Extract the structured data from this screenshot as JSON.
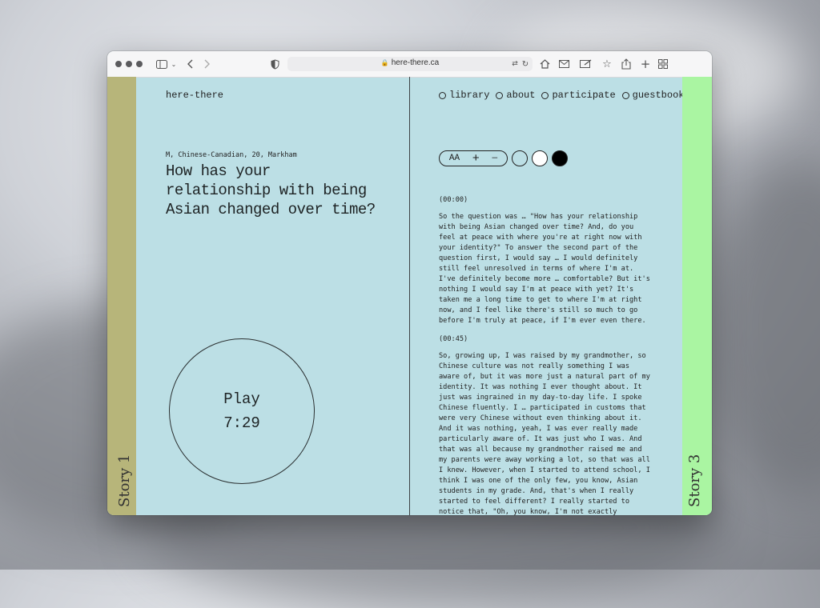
{
  "browser": {
    "url": "here-there.ca"
  },
  "site": {
    "logo": "here-there",
    "nav": [
      "library",
      "about",
      "participate",
      "guestbook"
    ]
  },
  "stories": {
    "left_label": "Story 1",
    "right_label": "Story 3",
    "left_color": "#b7b57a",
    "right_color": "#aaf5a2",
    "page_color": "#bcdfe5"
  },
  "story": {
    "meta": "M, Chinese-Canadian, 20, Markham",
    "question": "How has your relationship with being Asian changed over time?",
    "play_label": "Play",
    "duration": "7:29"
  },
  "controls": {
    "text_size_label": "AA",
    "increase_label": "+",
    "decrease_label": "—",
    "themes": [
      "transparent",
      "#ffffff",
      "#000000"
    ]
  },
  "transcript": [
    {
      "time": "(00:00)",
      "text": "So the question was … \"How has your relationship with being Asian changed over time? And, do you feel at peace with where you're at right now with your identity?\" To answer the second part of the question first, I would say … I would definitely still feel unresolved in terms of where I'm at. I've definitely become more … comfortable? But it's nothing I would say I'm at peace with yet? It's taken me a long time to get to where I'm at right now, and I feel like there's still so much to go before I'm truly at peace, if I'm ever even there."
    },
    {
      "time": "(00:45)",
      "text": "So, growing up, I was raised by my grandmother, so Chinese culture was not really something I was aware of, but it was more just a natural part of my identity. It was nothing I ever thought about. It just was ingrained in my day-to-day life. I spoke Chinese fluently. I … participated in customs that were very Chinese without even thinking about it. And it was nothing, yeah, I was ever really made particularly aware of. It was just who I was. And that was all because my grandmother raised me and my parents were away working a lot, so that was all I knew. However, when I started to attend school, I think I was one of the only few, you know, Asian students in my grade. And, that's when I really started to feel different? I really started to notice that, \"Oh, you know, I'm not exactly"
    }
  ]
}
